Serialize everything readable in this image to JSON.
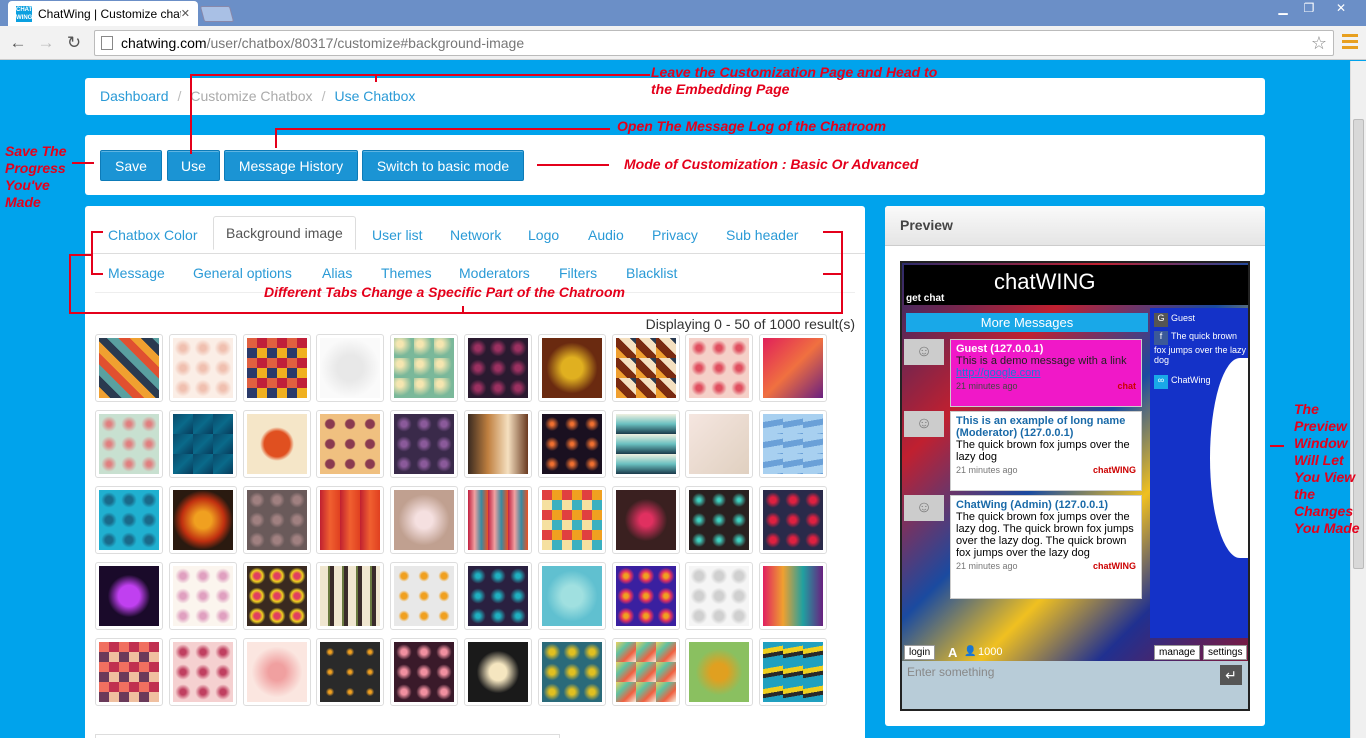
{
  "browser": {
    "tab_title": "ChatWing | Customize chatbo",
    "favicon_text": "CHAT WING",
    "url_host": "chatwing.com",
    "url_path": "/user/chatbox/80317/customize#background-image"
  },
  "breadcrumb": {
    "dashboard": "Dashboard",
    "customize": "Customize Chatbox",
    "use": "Use Chatbox"
  },
  "buttons": {
    "save": "Save",
    "use": "Use",
    "history": "Message History",
    "switch": "Switch to basic mode"
  },
  "tabs": [
    "Chatbox Color",
    "Background image",
    "User list",
    "Network",
    "Logo",
    "Audio",
    "Privacy",
    "Sub header",
    "Message",
    "General options",
    "Alias",
    "Themes",
    "Moderators",
    "Filters",
    "Blacklist"
  ],
  "results_text": "Displaying 0 - 50 of 1000 result(s)",
  "preview": {
    "title": "Preview",
    "logo": "chatWING",
    "get_chat": "get chat",
    "more_messages": "More Messages",
    "users": [
      {
        "icon": "G",
        "text": "Guest"
      },
      {
        "icon": "f",
        "text": "The quick brown fox jumps over the lazy dog"
      },
      {
        "icon": "∞",
        "text": "ChatWing"
      }
    ],
    "messages": [
      {
        "name": "Guest   (127.0.0.1)",
        "body": "This is a demo message with a link",
        "link": "http://google.com",
        "time": "21 minutes ago",
        "brand": "chat"
      },
      {
        "name": "This is an example of long name (Moderator)   (127.0.0.1)",
        "body": "The quick brown fox jumps over the lazy dog",
        "time": "21 minutes ago",
        "brand": "chatWING"
      },
      {
        "name": "ChatWing (Admin)   (127.0.0.1)",
        "body": "The quick brown fox jumps over the lazy dog. The quick brown fox jumps over the lazy dog. The quick brown fox jumps over the lazy dog",
        "time": "21 minutes ago",
        "brand": "chatWING"
      }
    ],
    "login": "login",
    "font_a": "A",
    "count": "1000",
    "manage": "manage",
    "settings": "settings",
    "input_placeholder": "Enter something"
  },
  "annotations": {
    "leave": "Leave the Customization Page and Head to the Embedding Page",
    "log": "Open The Message Log of the Chatroom",
    "save": "Save The Progress You've Made",
    "mode": "Mode of Customization : Basic Or Advanced",
    "tabs": "Different Tabs Change a Specific Part of the Chatroom",
    "preview": "The Preview Window Will Let You View the Changes You Made"
  },
  "colors": {
    "accent": "#1b94d4",
    "page_bg": "#00a3ec",
    "annotation": "#e4001b"
  }
}
